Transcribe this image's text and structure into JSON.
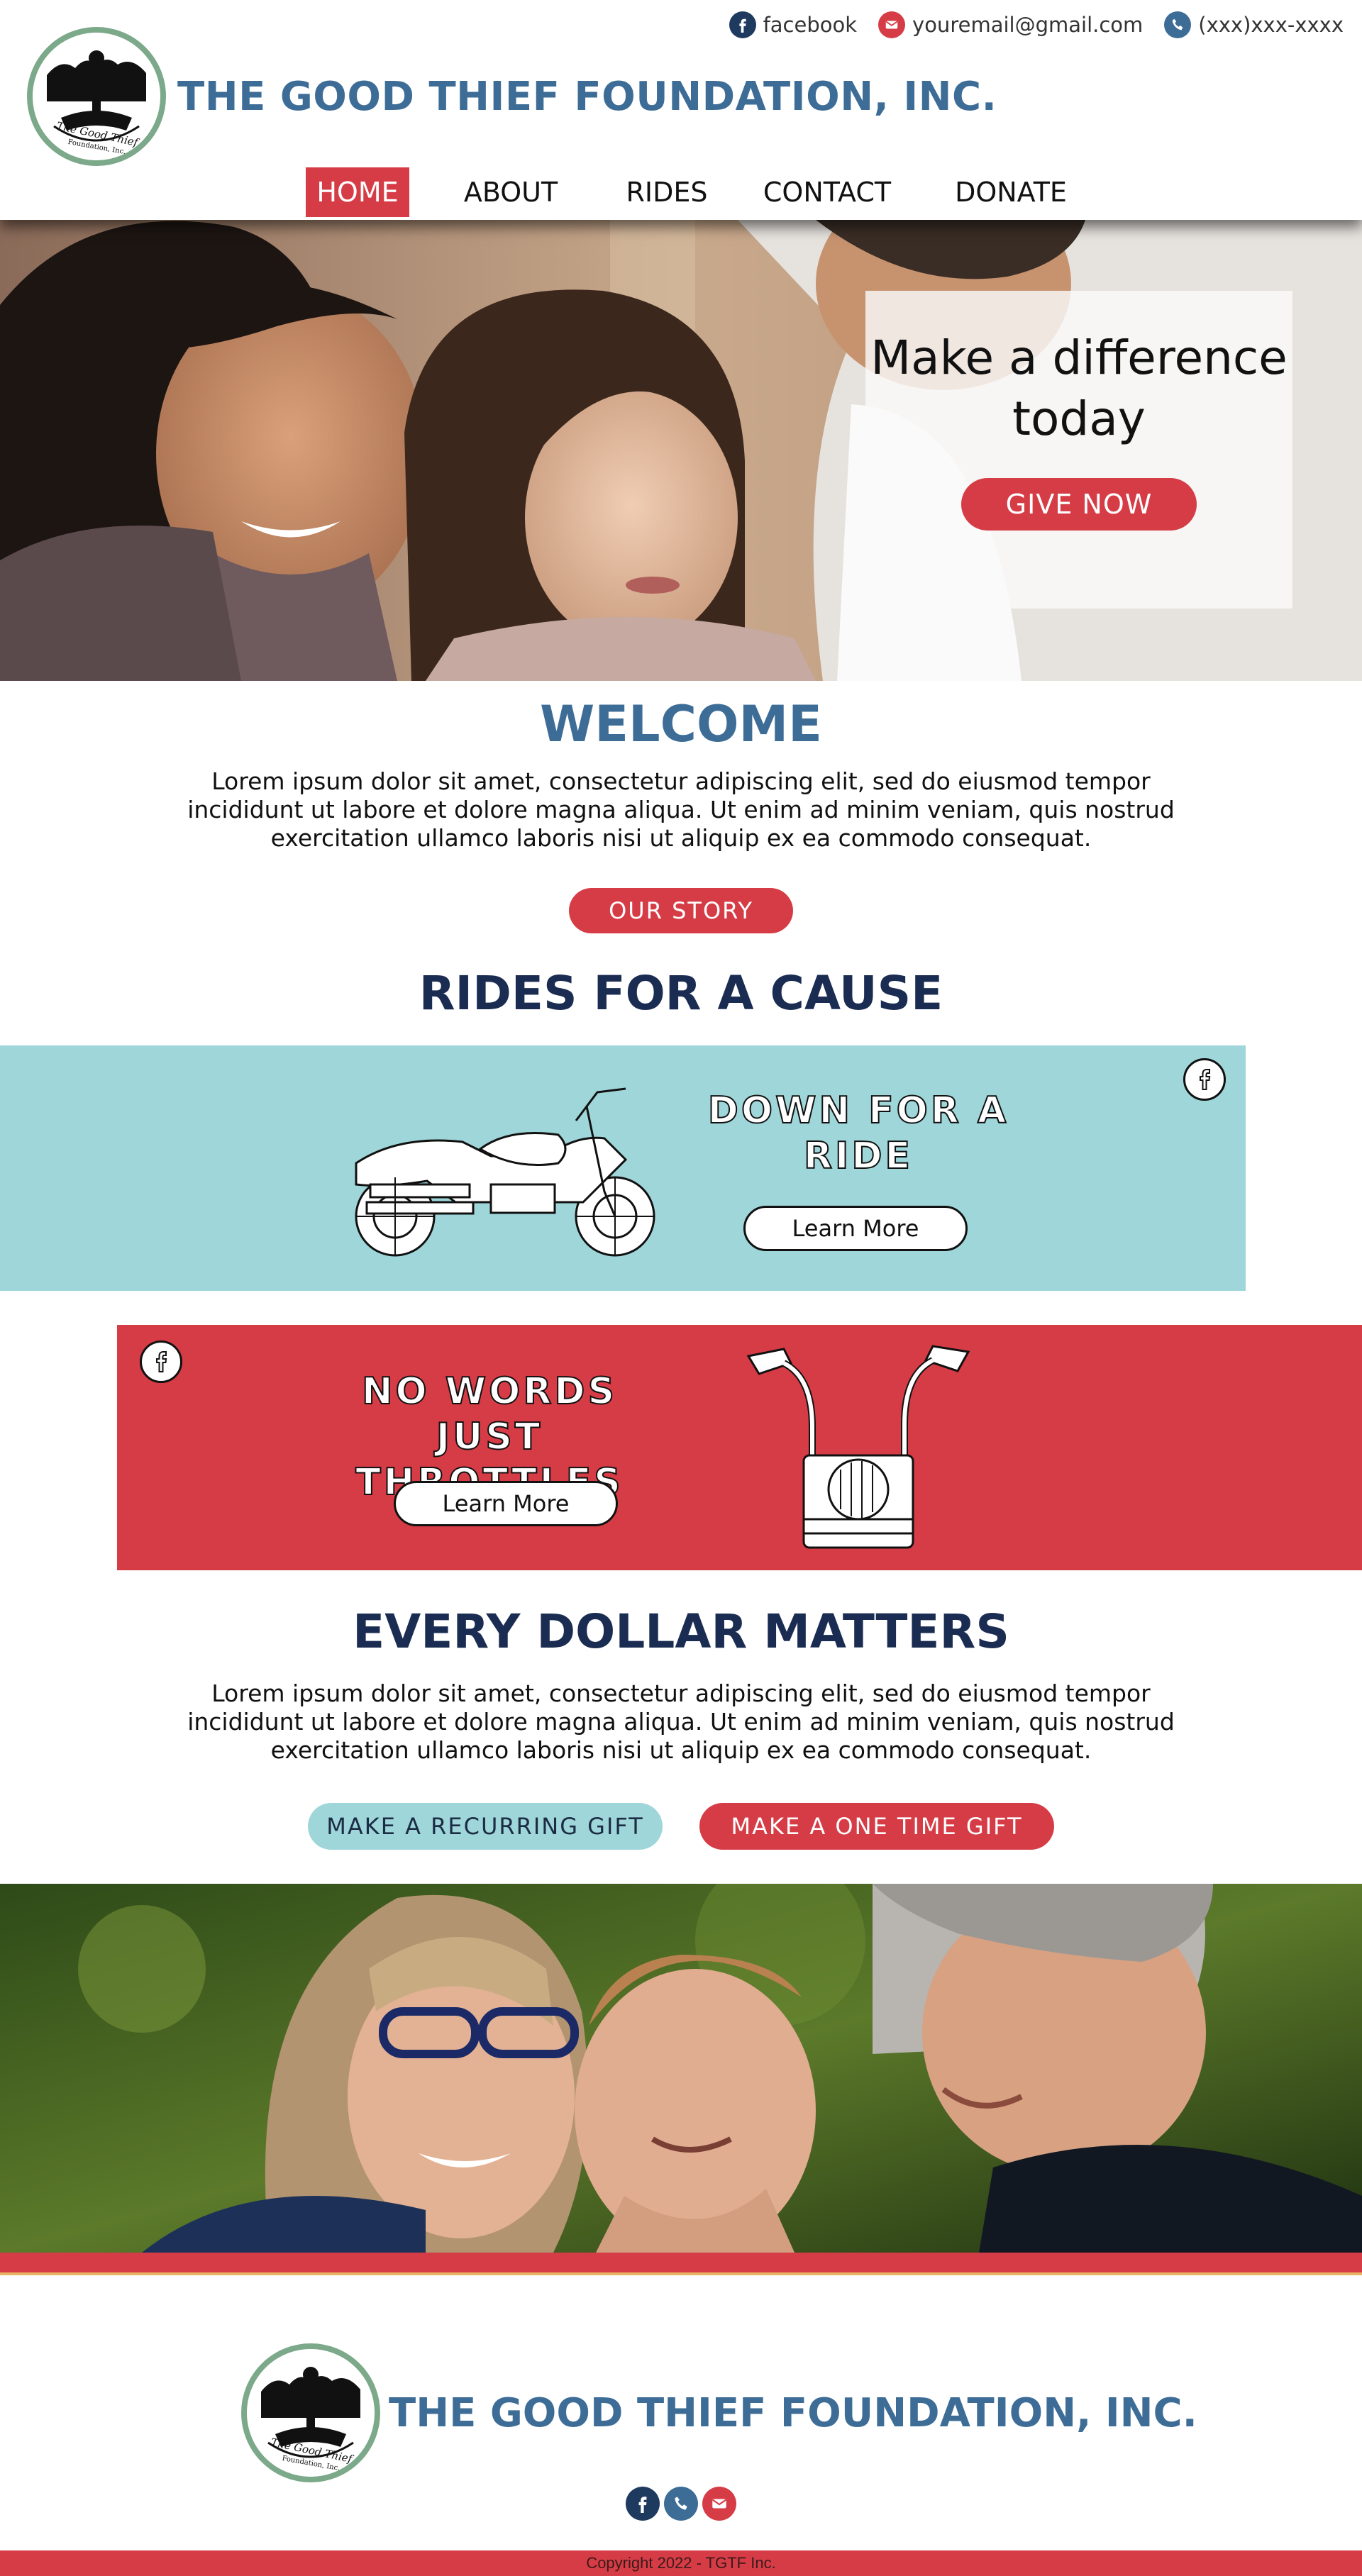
{
  "header": {
    "contacts": [
      {
        "icon": "facebook-icon",
        "label": "facebook"
      },
      {
        "icon": "email-icon",
        "label": "youremail@gmail.com"
      },
      {
        "icon": "phone-icon",
        "label": "(xxx)xxx-xxxx"
      }
    ],
    "logo_text": "The Good Thief Foundation, Inc.",
    "title": "THE GOOD THIEF FOUNDATION, INC.",
    "nav": [
      "HOME",
      "ABOUT",
      "RIDES",
      "CONTACT",
      "DONATE"
    ],
    "active_nav": "HOME"
  },
  "hero": {
    "heading": "Make a difference today",
    "button": "GIVE NOW"
  },
  "welcome": {
    "title": "WELCOME",
    "text": "Lorem ipsum dolor sit amet, consectetur adipiscing elit, sed do eiusmod tempor incididunt ut labore et dolore magna aliqua. Ut enim ad minim veniam, quis nostrud exercitation ullamco laboris nisi ut aliquip ex ea commodo consequat.",
    "button": "OUR STORY"
  },
  "rides": {
    "title": "RIDES FOR A CAUSE",
    "events": [
      {
        "heading": "DOWN FOR A RIDE",
        "button": "Learn More",
        "icon": "motorcycle-icon"
      },
      {
        "heading": "NO WORDS JUST THROTTLES",
        "button": "Learn More",
        "icon": "handlebars-icon"
      }
    ]
  },
  "donate": {
    "title": "EVERY DOLLAR MATTERS",
    "text": "Lorem ipsum dolor sit amet, consectetur adipiscing elit, sed do eiusmod tempor incididunt ut labore et dolore magna aliqua. Ut enim ad minim veniam, quis nostrud exercitation ullamco laboris nisi ut aliquip ex ea commodo consequat.",
    "recurring_button": "MAKE A RECURRING GIFT",
    "onetime_button": "MAKE A ONE TIME GIFT"
  },
  "footer": {
    "title": "THE GOOD THIEF FOUNDATION, INC.",
    "icons": [
      "facebook-icon",
      "phone-icon",
      "email-icon"
    ],
    "copyright": "Copyright 2022 -  TGTF Inc."
  },
  "colors": {
    "brand_blue": "#3d6d96",
    "navy": "#1b2c52",
    "accent_red": "#d63c46",
    "teal": "#9fd6da",
    "logo_ring": "#7ca98a"
  }
}
